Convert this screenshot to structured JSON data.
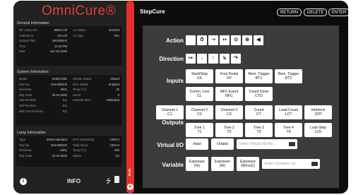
{
  "brand": {
    "logo": "OmniCure®"
  },
  "general": {
    "title": "General Information",
    "rows": [
      [
        "Eff. Lamp Life",
        "968H Left",
        "LG Status",
        "Inserted"
      ],
      [
        "Calibration",
        "0H Left",
        "LG Type",
        "N/A"
      ],
      [
        "Optical Filter",
        "400-500nm",
        "",
        ""
      ],
      [
        "Time",
        "12:43 PM",
        "",
        ""
      ],
      [
        "Date",
        "Jan 1st 2020",
        "",
        ""
      ]
    ]
  },
  "system": {
    "title": "System Information",
    "rows": [
      [
        "Model",
        "S2000 Elite",
        "Shutter Status",
        "Closed"
      ],
      [
        "Part No.",
        "019-00001R",
        "NFC Status",
        "Enabled"
      ],
      [
        "Serial No.",
        "0001",
        "Temp (°C)",
        "25"
      ],
      [
        "Mfg. Date",
        "23-01-2020",
        "Hours",
        "0"
      ],
      [
        "HW Revision",
        "0.1",
        "Intensity Mon.",
        "Calibrated"
      ],
      [
        "SW Revision",
        "0.1",
        "",
        ""
      ],
      [
        "Web GUI Revision",
        "0.1",
        "",
        ""
      ]
    ]
  },
  "lamp": {
    "title": "Lamp Information",
    "rows": [
      [
        "Type",
        "200W Standard",
        "WTY Remaining",
        "1000 H"
      ],
      [
        "Part No.",
        "019-00001R",
        "Total Hours",
        "1020 H"
      ],
      [
        "Serial No.",
        "0001",
        "Temp (°C)",
        "400"
      ],
      [
        "Mfg. Date",
        "23-01-2020",
        "Status",
        "On"
      ]
    ]
  },
  "footer": {
    "info": "INFO",
    "run": "RUN",
    "info_icon": "i"
  },
  "header": {
    "title": "StepCure",
    "buttons": [
      "RETURN",
      "DELETE",
      "ENTER"
    ]
  },
  "rows": {
    "action": "Action",
    "direction": "Direction",
    "inputs": "Inputs",
    "outputs": "Outputs",
    "virtual": "Virtual I/O",
    "variable": "Variable"
  },
  "action_icons": [
    "blank",
    "timer-icon",
    "shutter-open-icon",
    "shutter-close-icon",
    "intensity-up-icon",
    "intensity-down-icon",
    "speaker-icon"
  ],
  "direction_icons": [
    "arrow-right-icon",
    "arrow-down-icon",
    "arrow-up-icon",
    "arrow-return-icon",
    "arrow-loop-icon"
  ],
  "inputs": [
    [
      "Start/Stop",
      "SS"
    ],
    [
      "Foot Pedal",
      "FP"
    ],
    [
      "Rem. Trigger",
      "RT1"
    ],
    [
      "Rem. Trigger",
      "RT2"
    ],
    [
      "Comm. Line",
      "CL"
    ],
    [
      "NFC Event",
      "NFC"
    ],
    [
      "Count Done",
      "CTD"
    ]
  ],
  "outputs": [
    [
      "Channel 1",
      "C1"
    ],
    [
      "Channel 2",
      "C2"
    ],
    [
      "Channel 3",
      "C3"
    ],
    [
      "Count",
      "CT"
    ],
    [
      "Load Count",
      "LCT"
    ],
    [
      "Interlock",
      "STP"
    ],
    [
      "Tree 1",
      "T1"
    ],
    [
      "Tree 2",
      "T2"
    ],
    [
      "Tree 3",
      "T3"
    ],
    [
      "Tree 4",
      "T4"
    ],
    [
      "Lock-Step",
      "LCK"
    ]
  ],
  "virtual": {
    "buttons": [
      "Input",
      "Output"
    ],
    "placeholder": "Enter Virtual I/O No."
  },
  "variable": {
    "buttons": [
      [
        "Exposure",
        "(%)"
      ],
      [
        "Exposure",
        "(W)"
      ],
      [
        "Exposure",
        "(W/cm2)"
      ]
    ],
    "placeholder": "Enter Duration (s)"
  },
  "colors": {
    "accent": "#e4302c",
    "panel": "#3c3c3c",
    "background": "#0c0c0c"
  }
}
